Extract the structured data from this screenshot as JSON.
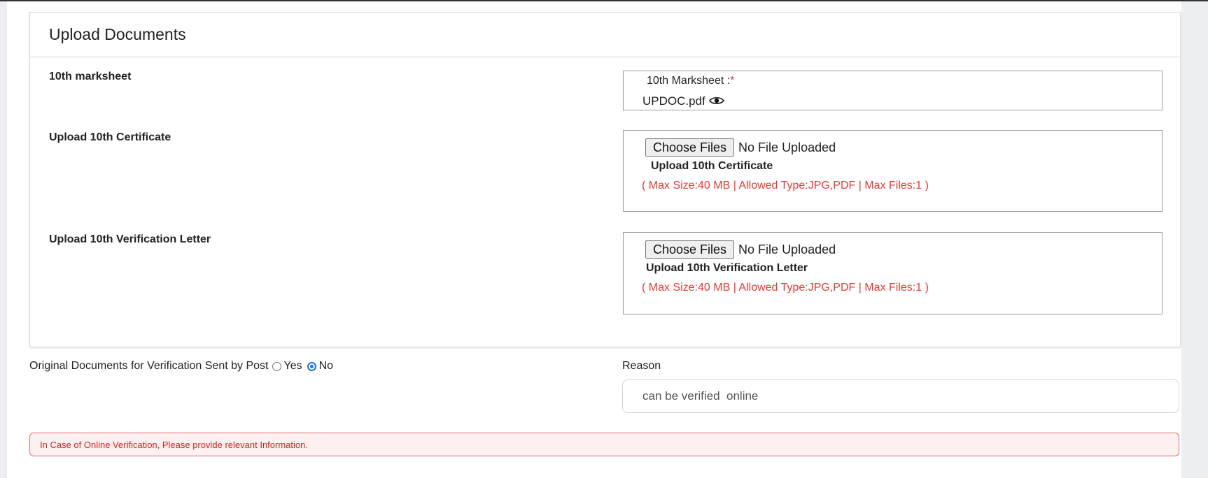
{
  "panel": {
    "title": "Upload Documents"
  },
  "rows": [
    {
      "label": "10th marksheet",
      "field_label": "10th Marksheet :",
      "required_mark": "*",
      "uploaded_file": "UPDOC.pdf",
      "view_icon": "eye-icon"
    },
    {
      "label": "Upload 10th Certificate",
      "choose_button": "Choose Files",
      "file_status": "No File Uploaded",
      "caption": "Upload 10th Certificate",
      "limits": "( Max Size:40 MB | Allowed Type:JPG,PDF | Max Files:1 )"
    },
    {
      "label": "Upload 10th Verification Letter",
      "choose_button": "Choose Files",
      "file_status": "No File Uploaded",
      "caption": "Upload 10th Verification Letter",
      "limits": "( Max Size:40 MB | Allowed Type:JPG,PDF | Max Files:1 )"
    }
  ],
  "post_verification": {
    "question": "Original Documents for Verification Sent by Post",
    "options": [
      "Yes",
      "No"
    ],
    "selected": "No"
  },
  "reason": {
    "label": "Reason",
    "value": "can be verified  online"
  },
  "alert": {
    "text": "In Case of Online Verification, Please provide relevant Information."
  },
  "colors": {
    "required": "#d32f2f",
    "limits_text": "#e53935",
    "radio_selected": "#1a73e8",
    "alert_border": "#e06c6c",
    "alert_background": "#fdf0f0"
  }
}
